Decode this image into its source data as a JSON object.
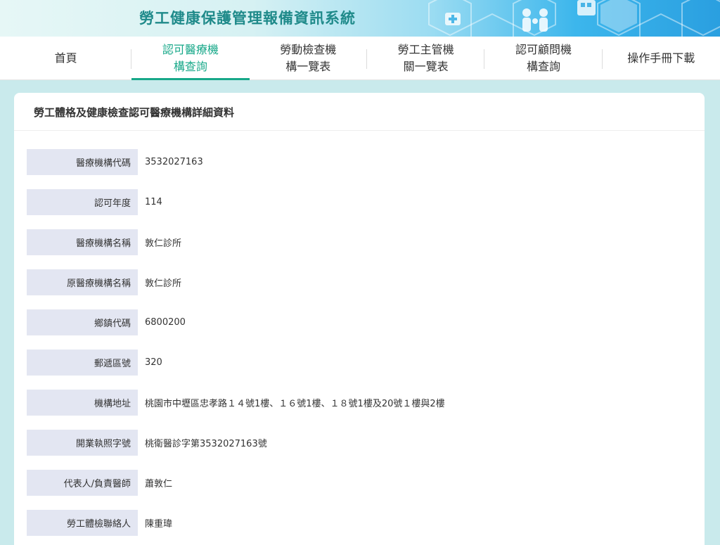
{
  "header": {
    "title": "勞工健康保護管理報備資訊系統",
    "brand_color": "#1f8a8a"
  },
  "nav": {
    "items": [
      {
        "label": "首頁",
        "active": false
      },
      {
        "label": "認可醫療機\n構查詢",
        "active": true
      },
      {
        "label": "勞動檢查機\n構一覽表",
        "active": false
      },
      {
        "label": "勞工主管機\n關一覽表",
        "active": false
      },
      {
        "label": "認可顧問機\n構查詢",
        "active": false
      },
      {
        "label": "操作手冊下載",
        "active": false
      }
    ],
    "active_color": "#17a889"
  },
  "card": {
    "title": "勞工體格及健康檢查認可醫療機構詳細資料",
    "rows": [
      {
        "label": "醫療機構代碼",
        "value": "3532027163"
      },
      {
        "label": "認可年度",
        "value": "114"
      },
      {
        "label": "醫療機構名稱",
        "value": "敦仁診所"
      },
      {
        "label": "原醫療機構名稱",
        "value": "敦仁診所"
      },
      {
        "label": "鄉鎮代碼",
        "value": "6800200"
      },
      {
        "label": "郵遞區號",
        "value": "320"
      },
      {
        "label": "機構地址",
        "value": "桃園市中壢區忠孝路１４號1樓、１６號1樓、１８號1樓及20號１樓與2樓"
      },
      {
        "label": "開業執照字號",
        "value": "桃衛醫診字第3532027163號"
      },
      {
        "label": "代表人/負責醫師",
        "value": "蕭敦仁"
      },
      {
        "label": "勞工體檢聯絡人",
        "value": "陳重瑋"
      }
    ]
  },
  "icons": [
    "hexagon-pattern-icon",
    "family-icon",
    "medical-kit-icon"
  ]
}
